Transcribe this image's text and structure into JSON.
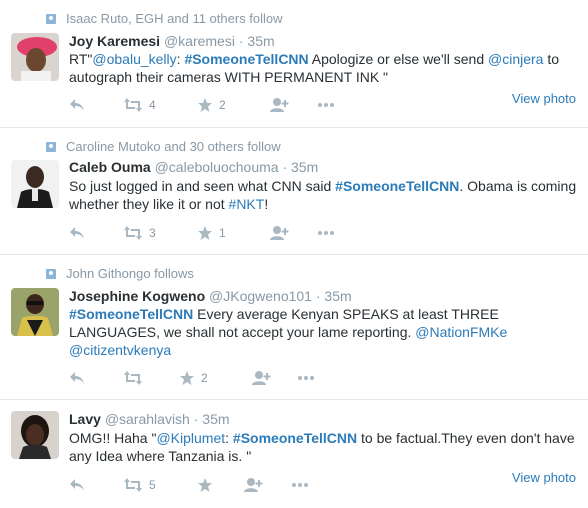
{
  "tweets": [
    {
      "context": "Isaac Ruto, EGH and 11 others follow",
      "name": "Joy Karemesi",
      "handle": "@karemesi",
      "time": "35m",
      "retweets": "4",
      "favorites": "2",
      "view_photo": "View photo",
      "text_parts": [
        "RT\"",
        "@obalu_kelly",
        ": ",
        "#SomeoneTellCNN",
        " Apologize or else we'll send ",
        "@cinjera",
        " to autograph their cameras WITH PERMANENT INK \""
      ]
    },
    {
      "context": "Caroline Mutoko and 30 others follow",
      "name": "Caleb Ouma",
      "handle": "@caleboluochouma",
      "time": "35m",
      "retweets": "3",
      "favorites": "1",
      "text_parts": [
        "So just logged in and seen what CNN said ",
        "#SomeoneTellCNN",
        ". Obama is coming whether they like it or not ",
        "#NKT",
        "!"
      ]
    },
    {
      "context": "John Githongo follows",
      "name": "Josephine Kogweno",
      "handle": "@JKogweno101",
      "time": "35m",
      "retweets": "",
      "favorites": "2",
      "text_parts": [
        "#SomeoneTellCNN",
        " Every average Kenyan SPEAKS at least THREE LANGUAGES, we shall not accept your lame reporting. ",
        "@NationFMKe",
        " ",
        "@citizentvkenya"
      ]
    },
    {
      "name": "Lavy",
      "handle": "@sarahlavish",
      "time": "35m",
      "retweets": "5",
      "favorites": "",
      "view_photo": "View photo",
      "text_parts": [
        "OMG!! Haha \"",
        "@Kiplumet",
        ": ",
        "#SomeoneTellCNN",
        " to be factual.They even don't have any Idea where Tanzania is. \""
      ]
    }
  ],
  "separator": "·",
  "colors": {
    "link": "#2b7bb9",
    "muted": "#8899a6",
    "border": "#e1e8ed"
  },
  "icons": [
    "people-follow-icon",
    "reply-icon",
    "retweet-icon",
    "favorite-icon",
    "follow-icon",
    "more-icon"
  ]
}
